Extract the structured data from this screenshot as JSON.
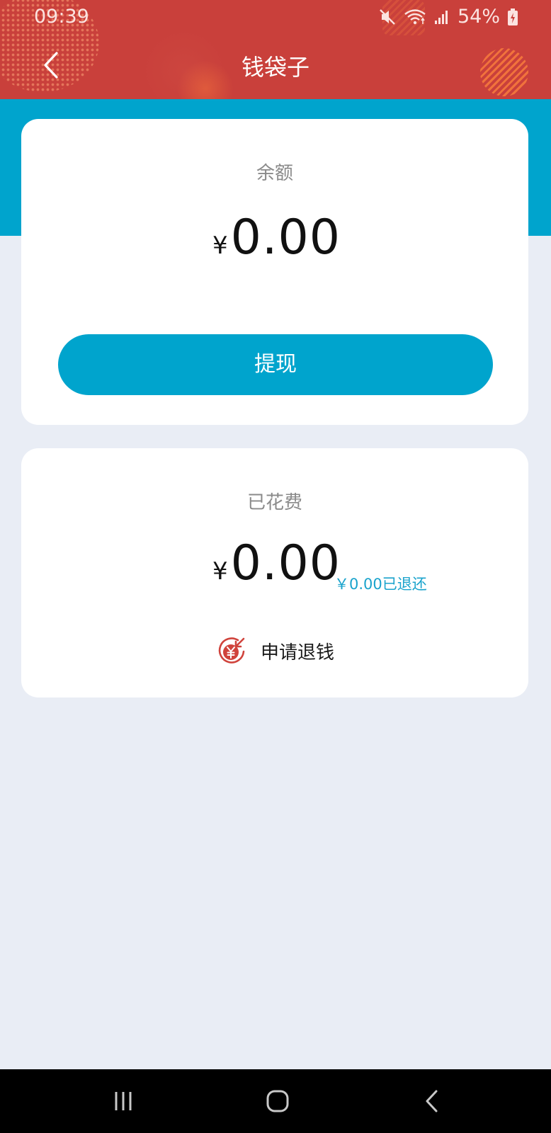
{
  "status_bar": {
    "time": "09:39",
    "battery": "54%",
    "icons": [
      "mute-icon",
      "wifi-icon",
      "signal-icon",
      "battery-charging-icon"
    ]
  },
  "header": {
    "title": "钱袋子",
    "back_icon": "chevron-left-icon"
  },
  "balance_card": {
    "label": "余额",
    "currency": "¥",
    "amount": "0.00",
    "button_label": "提现"
  },
  "spent_card": {
    "label": "已花费",
    "currency": "¥",
    "amount": "0.00",
    "refunded_note": "￥0.00已退还",
    "refund_label": "申请退钱",
    "refund_icon": "refund-yen-icon"
  },
  "system_nav": {
    "icons": [
      "recents-icon",
      "home-icon",
      "back-icon"
    ]
  },
  "colors": {
    "header_red": "#c9403b",
    "accent_blue": "#00a4cd",
    "background": "#e9edf5",
    "refund_red": "#d0433c"
  }
}
